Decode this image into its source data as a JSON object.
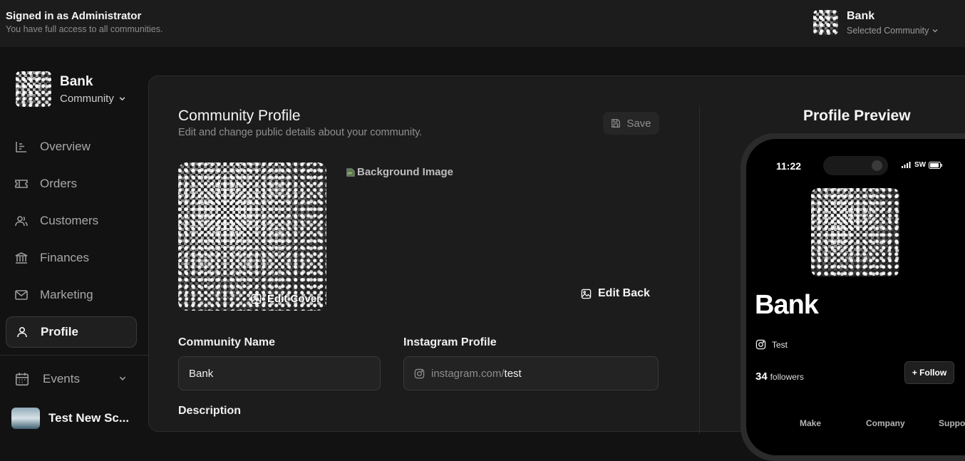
{
  "header": {
    "signed_in_title": "Signed in as Administrator",
    "signed_in_subtitle": "You have full access to all communities.",
    "community_name": "Bank",
    "community_subtitle": "Selected Community"
  },
  "sidebar": {
    "community_name": "Bank",
    "community_type": "Community",
    "items": [
      {
        "label": "Overview",
        "icon": "chart-icon"
      },
      {
        "label": "Orders",
        "icon": "ticket-icon"
      },
      {
        "label": "Customers",
        "icon": "users-icon"
      },
      {
        "label": "Finances",
        "icon": "bank-icon"
      },
      {
        "label": "Marketing",
        "icon": "mail-icon"
      },
      {
        "label": "Profile",
        "icon": "user-icon",
        "active": true
      }
    ],
    "events_label": "Events",
    "event_item": "Test New Sc..."
  },
  "main": {
    "title": "Community Profile",
    "subtitle": "Edit and change public details about your community.",
    "save_label": "Save",
    "edit_cover_label": "Edit Cover",
    "background_image_alt": "Background Image",
    "edit_back_label": "Edit Back",
    "community_name_label": "Community Name",
    "community_name_value": "Bank",
    "instagram_label": "Instagram Profile",
    "instagram_prefix": "instagram.com/",
    "instagram_value": "test",
    "description_label": "Description"
  },
  "preview": {
    "title": "Profile Preview",
    "time": "11:22",
    "carrier": "SW",
    "name": "Bank",
    "instagram": "Test",
    "followers_count": "34",
    "followers_label": "followers",
    "follow_label": "+ Follow",
    "tabs": [
      "Make",
      "Company",
      "Suppo"
    ]
  },
  "colors": {
    "background": "#121212",
    "panel": "#1c1c1c",
    "active_border": "#3a3a3a"
  }
}
